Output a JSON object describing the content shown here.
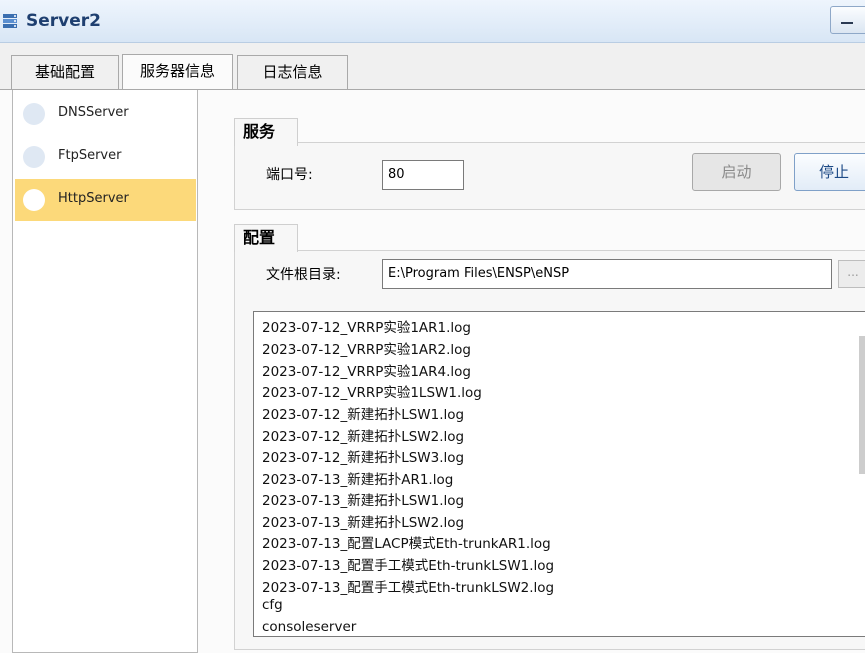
{
  "window": {
    "title": "Server2",
    "icon": "server-icon"
  },
  "tabs": [
    {
      "label": "基础配置",
      "active": false
    },
    {
      "label": "服务器信息",
      "active": true
    },
    {
      "label": "日志信息",
      "active": false
    }
  ],
  "servers": [
    {
      "label": "DNSServer",
      "selected": false
    },
    {
      "label": "FtpServer",
      "selected": false
    },
    {
      "label": "HttpServer",
      "selected": true
    }
  ],
  "service": {
    "group_title": "服务",
    "port_label": "端口号:",
    "port_value": "80",
    "start_label": "启动",
    "stop_label": "停止"
  },
  "config": {
    "group_title": "配置",
    "root_label": "文件根目录:",
    "root_value": "E:\\Program Files\\ENSP\\eNSP",
    "browse_label": "..."
  },
  "files": [
    "2023-07-12_VRRP实验1AR1.log",
    "2023-07-12_VRRP实验1AR2.log",
    "2023-07-12_VRRP实验1AR4.log",
    "2023-07-12_VRRP实验1LSW1.log",
    "2023-07-12_新建拓扑LSW1.log",
    "2023-07-12_新建拓扑LSW2.log",
    "2023-07-12_新建拓扑LSW3.log",
    "2023-07-13_新建拓扑AR1.log",
    "2023-07-13_新建拓扑LSW1.log",
    "2023-07-13_新建拓扑LSW2.log",
    "2023-07-13_配置LACP模式Eth-trunkAR1.log",
    "2023-07-13_配置手工模式Eth-trunkLSW1.log",
    "2023-07-13_配置手工模式Eth-trunkLSW2.log",
    "cfg",
    "consoleserver"
  ],
  "colors": {
    "selected": "#fcd97a",
    "title": "#1e3f70"
  }
}
